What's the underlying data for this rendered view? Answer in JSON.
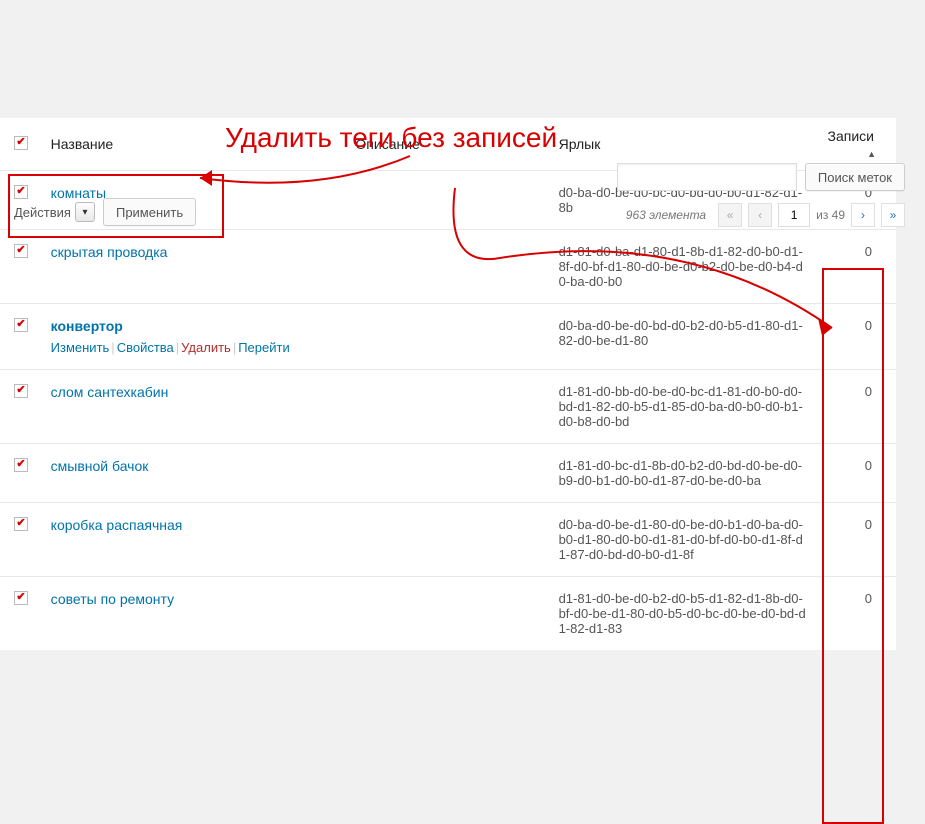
{
  "annotation": {
    "title": "Удалить теги без записей"
  },
  "search": {
    "placeholder": "",
    "button_label": "Поиск меток"
  },
  "bulk": {
    "actions_label": "Действия",
    "apply_label": "Применить"
  },
  "pagination": {
    "count_text": "963 элемента",
    "current_page": "1",
    "of_text": "из 49"
  },
  "columns": {
    "name": "Название",
    "description": "Описание",
    "slug": "Ярлык",
    "count": "Записи"
  },
  "row_actions": {
    "edit": "Изменить",
    "properties": "Свойства",
    "delete": "Удалить",
    "view": "Перейти"
  },
  "rows": [
    {
      "name": "комнаты",
      "slug": "d0-ba-d0-be-d0-bc-d0-bd-d0-b0-d1-82-d1-8b",
      "count": "0",
      "checked": true,
      "show_actions": false
    },
    {
      "name": "скрытая проводка",
      "slug": "d1-81-d0-ba-d1-80-d1-8b-d1-82-d0-b0-d1-8f-d0-bf-d1-80-d0-be-d0-b2-d0-be-d0-b4-d0-ba-d0-b0",
      "count": "0",
      "checked": true,
      "show_actions": false
    },
    {
      "name": "конвертор",
      "slug": "d0-ba-d0-be-d0-bd-d0-b2-d0-b5-d1-80-d1-82-d0-be-d1-80",
      "count": "0",
      "checked": true,
      "show_actions": true
    },
    {
      "name": "слом сантехкабин",
      "slug": "d1-81-d0-bb-d0-be-d0-bc-d1-81-d0-b0-d0-bd-d1-82-d0-b5-d1-85-d0-ba-d0-b0-d0-b1-d0-b8-d0-bd",
      "count": "0",
      "checked": true,
      "show_actions": false
    },
    {
      "name": "смывной бачок",
      "slug": "d1-81-d0-bc-d1-8b-d0-b2-d0-bd-d0-be-d0-b9-d0-b1-d0-b0-d1-87-d0-be-d0-ba",
      "count": "0",
      "checked": true,
      "show_actions": false
    },
    {
      "name": "коробка распаячная",
      "slug": "d0-ba-d0-be-d1-80-d0-be-d0-b1-d0-ba-d0-b0-d1-80-d0-b0-d1-81-d0-bf-d0-b0-d1-8f-d1-87-d0-bd-d0-b0-d1-8f",
      "count": "0",
      "checked": true,
      "show_actions": false
    },
    {
      "name": "советы по ремонту",
      "slug": "d1-81-d0-be-d0-b2-d0-b5-d1-82-d1-8b-d0-bf-d0-be-d1-80-d0-b5-d0-bc-d0-be-d0-bd-d1-82-d1-83",
      "count": "0",
      "checked": true,
      "show_actions": false
    }
  ]
}
